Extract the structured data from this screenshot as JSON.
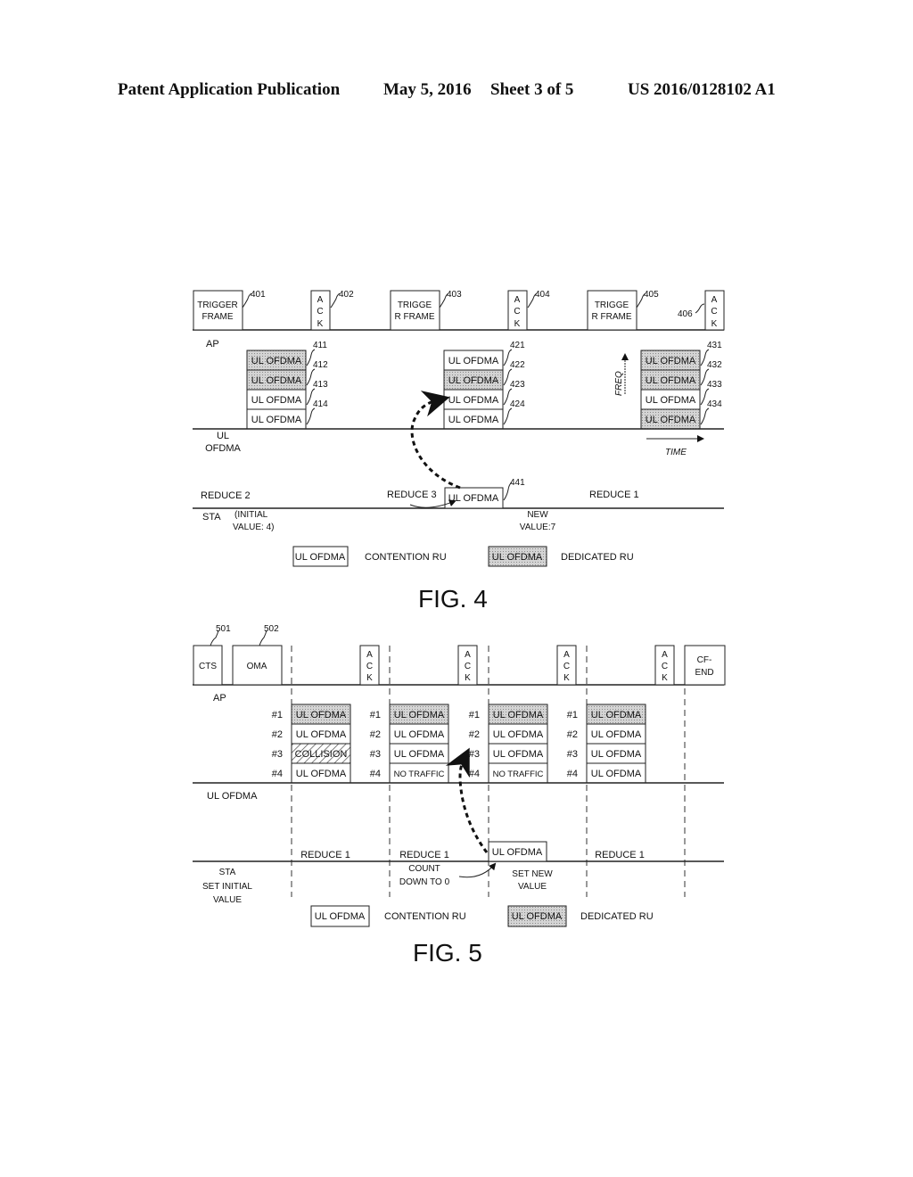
{
  "header": {
    "publication": "Patent Application Publication",
    "date": "May 5, 2016",
    "sheet": "Sheet 3 of 5",
    "number": "US 2016/0128102 A1"
  },
  "fig4": {
    "caption": "FIG. 4",
    "ap_label": "AP",
    "ul_label_1": "UL",
    "ul_label_2": "OFDMA",
    "sta_label": "STA",
    "frames": [
      {
        "line1": "TRIGGER",
        "line2": "FRAME",
        "ref": "401"
      },
      {
        "ack": [
          "A",
          "C",
          "K"
        ],
        "ref": "402"
      },
      {
        "line1": "TRIGGE",
        "line2": "R FRAME",
        "ref": "403"
      },
      {
        "ack": [
          "A",
          "C",
          "K"
        ],
        "ref": "404"
      },
      {
        "line1": "TRIGGE",
        "line2": "R FRAME",
        "ref": "405"
      },
      {
        "ack": [
          "A",
          "C",
          "K"
        ],
        "ref": "406"
      }
    ],
    "ru_groups": [
      {
        "rus": [
          {
            "label": "UL OFDMA",
            "type": "dedicated",
            "ref": "411"
          },
          {
            "label": "UL OFDMA",
            "type": "dedicated",
            "ref": "412"
          },
          {
            "label": "UL OFDMA",
            "type": "contention",
            "ref": "413"
          },
          {
            "label": "UL OFDMA",
            "type": "contention",
            "ref": "414"
          }
        ]
      },
      {
        "rus": [
          {
            "label": "UL OFDMA",
            "type": "contention",
            "ref": "421"
          },
          {
            "label": "UL OFDMA",
            "type": "dedicated",
            "ref": "422"
          },
          {
            "label": "UL OFDMA",
            "type": "contention",
            "ref": "423"
          },
          {
            "label": "UL OFDMA",
            "type": "contention",
            "ref": "424"
          }
        ]
      },
      {
        "rus": [
          {
            "label": "UL OFDMA",
            "type": "dedicated",
            "ref": "431"
          },
          {
            "label": "UL OFDMA",
            "type": "dedicated",
            "ref": "432"
          },
          {
            "label": "UL OFDMA",
            "type": "contention",
            "ref": "433"
          },
          {
            "label": "UL OFDMA",
            "type": "dedicated",
            "ref": "434"
          }
        ]
      }
    ],
    "freq_label": "FREQ",
    "time_label": "TIME",
    "sta_ru": {
      "label": "UL OFDMA",
      "ref": "441"
    },
    "reduce_2": "REDUCE 2",
    "reduce_3": "REDUCE 3",
    "reduce_1": "REDUCE 1",
    "initial_1": "(INITIAL",
    "initial_2": "VALUE: 4)",
    "new_1": "NEW",
    "new_2": "VALUE:7",
    "legend": {
      "contention_box": "UL OFDMA",
      "contention_label": "CONTENTION RU",
      "dedicated_box": "UL OFDMA",
      "dedicated_label": "DEDICATED RU"
    }
  },
  "fig5": {
    "caption": "FIG. 5",
    "cts": {
      "label": "CTS",
      "ref": "501"
    },
    "oma": {
      "label": "OMA",
      "ref": "502"
    },
    "ack": [
      "A",
      "C",
      "K"
    ],
    "cf_end_1": "CF-",
    "cf_end_2": "END",
    "ap_label": "AP",
    "ul_label": "UL OFDMA",
    "sta_label": "STA",
    "set_initial_1": "SET INITIAL",
    "set_initial_2": "VALUE",
    "ru_index": [
      "#1",
      "#2",
      "#3",
      "#4"
    ],
    "ru_groups": [
      {
        "rus": [
          {
            "label": "UL OFDMA",
            "type": "dedicated"
          },
          {
            "label": "UL OFDMA",
            "type": "contention"
          },
          {
            "label": "COLLISION",
            "type": "collision"
          },
          {
            "label": "UL OFDMA",
            "type": "contention"
          }
        ]
      },
      {
        "rus": [
          {
            "label": "UL OFDMA",
            "type": "dedicated"
          },
          {
            "label": "UL OFDMA",
            "type": "contention"
          },
          {
            "label": "UL OFDMA",
            "type": "contention"
          },
          {
            "label": "NO TRAFFIC",
            "type": "contention"
          }
        ]
      },
      {
        "rus": [
          {
            "label": "UL OFDMA",
            "type": "dedicated"
          },
          {
            "label": "UL OFDMA",
            "type": "contention"
          },
          {
            "label": "UL OFDMA",
            "type": "contention"
          },
          {
            "label": "NO TRAFFIC",
            "type": "contention"
          }
        ]
      },
      {
        "rus": [
          {
            "label": "UL OFDMA",
            "type": "dedicated"
          },
          {
            "label": "UL OFDMA",
            "type": "contention"
          },
          {
            "label": "UL OFDMA",
            "type": "contention"
          },
          {
            "label": "UL OFDMA",
            "type": "contention"
          }
        ]
      }
    ],
    "sta_ru": "UL OFDMA",
    "reduce_1": "REDUCE 1",
    "count_1": "COUNT",
    "count_2": "DOWN TO 0",
    "set_new_1": "SET NEW",
    "set_new_2": "VALUE",
    "legend": {
      "contention_box": "UL OFDMA",
      "contention_label": "CONTENTION RU",
      "dedicated_box": "UL OFDMA",
      "dedicated_label": "DEDICATED RU"
    }
  }
}
